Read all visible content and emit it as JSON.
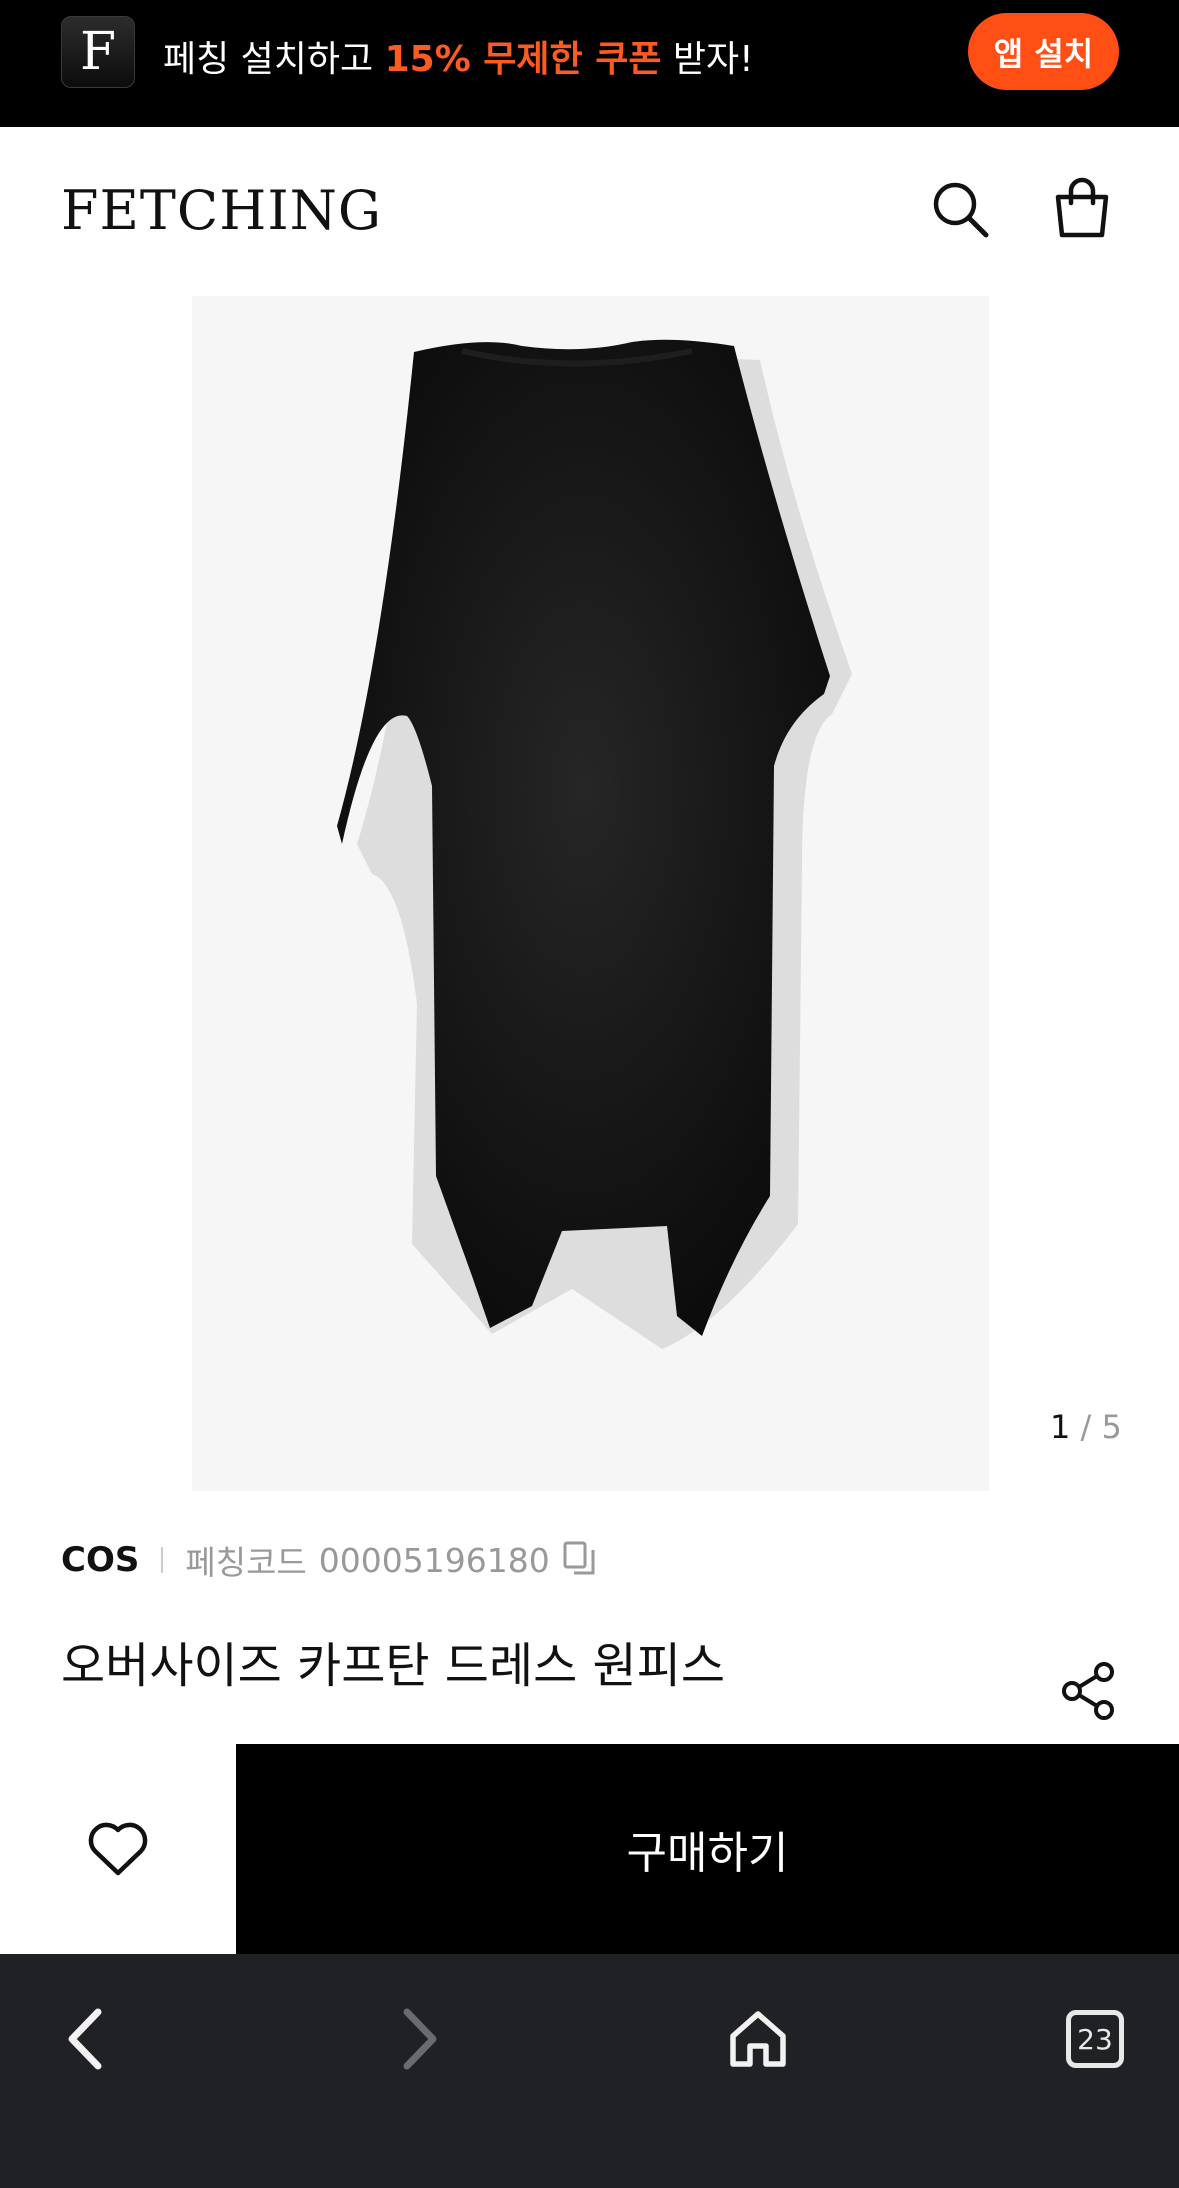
{
  "promo": {
    "logo_letter": "F",
    "text_prefix": "페칭 설치하고 ",
    "text_highlight": "15% 무제한 쿠폰",
    "text_suffix": " 받자!",
    "install_label": "앱 설치",
    "accent_color": "#ff4f14"
  },
  "header": {
    "brand": "FETCHING",
    "icons": [
      "search-icon",
      "shopping-bag-icon"
    ]
  },
  "gallery": {
    "current": "1",
    "separator": " / ",
    "total": "5"
  },
  "product": {
    "brand": "COS",
    "code_label": "페칭코드",
    "code_value": "00005196180",
    "name": "오버사이즈 카프탄 드레스 원피스"
  },
  "actions": {
    "buy_label": "구매하기",
    "wishlist_icon": "heart-icon"
  },
  "browser": {
    "tab_count": "23",
    "icons": [
      "back-icon",
      "forward-icon",
      "home-icon",
      "tabs-icon"
    ]
  }
}
